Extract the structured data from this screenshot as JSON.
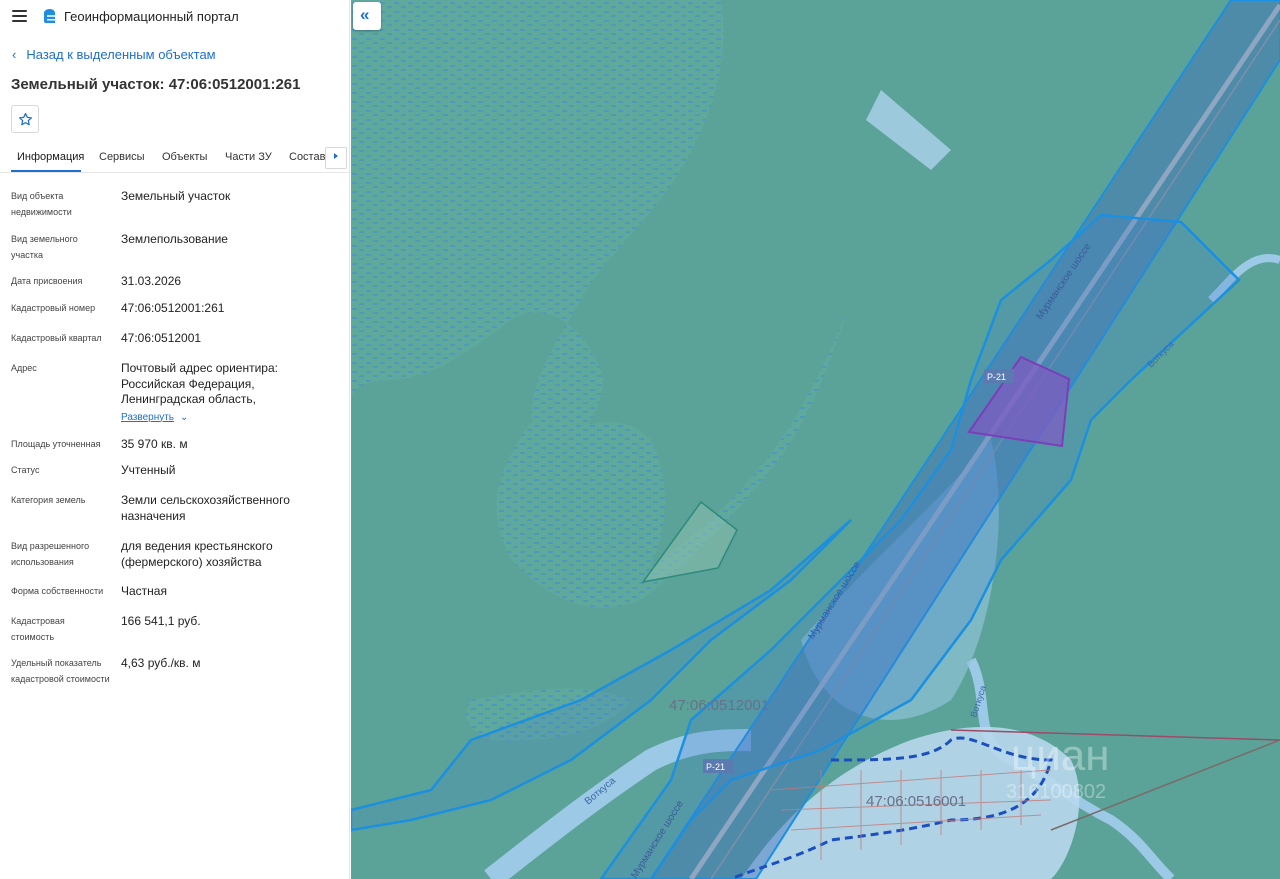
{
  "app": {
    "title": "Геоинформационный портал"
  },
  "nav": {
    "back_label": "Назад к выделенным объектам"
  },
  "page": {
    "title": "Земельный участок: 47:06:0512001:261"
  },
  "tabs": [
    {
      "label": "Информация"
    },
    {
      "label": "Сервисы"
    },
    {
      "label": "Объекты"
    },
    {
      "label": "Части ЗУ"
    },
    {
      "label": "Состав"
    }
  ],
  "info": {
    "object_type": {
      "label": "Вид объекта недвижимости",
      "value": "Земельный участок"
    },
    "land_type": {
      "label": "Вид земельного участка",
      "value": "Землепользование"
    },
    "assign_date": {
      "label": "Дата присвоения",
      "value": "31.03.2026"
    },
    "cadastral_number": {
      "label": "Кадастровый номер",
      "value": "47:06:0512001:261"
    },
    "cadastral_quarter": {
      "label": "Кадастровый квартал",
      "value": "47:06:0512001"
    },
    "address": {
      "label": "Адрес",
      "value": "Почтовый адрес ориентира: Российская Федерация, Ленинградская область,",
      "expand_label": "Развернуть"
    },
    "area": {
      "label": "Площадь уточненная",
      "value": "35 970 кв. м"
    },
    "status": {
      "label": "Статус",
      "value": "Учтенный"
    },
    "land_category": {
      "label": "Категория земель",
      "value": "Земли сельскохозяйственного назначения"
    },
    "permitted_use": {
      "label": "Вид разрешенного использования",
      "value": "для ведения крестьянского (фермерского) хозяйства"
    },
    "ownership": {
      "label": "Форма собственности",
      "value": "Частная"
    },
    "cadastral_value": {
      "label": "Кадастровая стоимость",
      "value": "166 541,1 руб."
    },
    "specific_value": {
      "label": "Удельный показатель кадастровой стоимости",
      "value": "4,63 руб./кв. м"
    }
  },
  "map": {
    "labels": {
      "quarter_1": "47:06:0512001",
      "quarter_2": "47:06:0516001",
      "road_1": "Мурманское шоссе",
      "road_2": "Мурманское шоссе",
      "road_3": "Мурманское шоссе",
      "road_sign_1": "Р-21",
      "road_sign_2": "Р-21",
      "river_1": "Воткуса",
      "river_2": "Воткуса",
      "river_3": "Воткуса",
      "watermark": "циан",
      "watermark_id": "316100802"
    }
  },
  "colors": {
    "accent": "#1e6fd0",
    "map_background": "#5ba398",
    "parcel_outline": "#1b8fe0",
    "selected_parcel": "#7e5bc2"
  },
  "icons": {
    "menu": "menu-icon",
    "logo": "logo-icon",
    "back": "chevron-left-icon",
    "favorite": "star-icon",
    "tab_scroll": "chevron-right-icon",
    "expand": "chevron-down-icon",
    "collapse": "double-chevron-left-icon"
  }
}
